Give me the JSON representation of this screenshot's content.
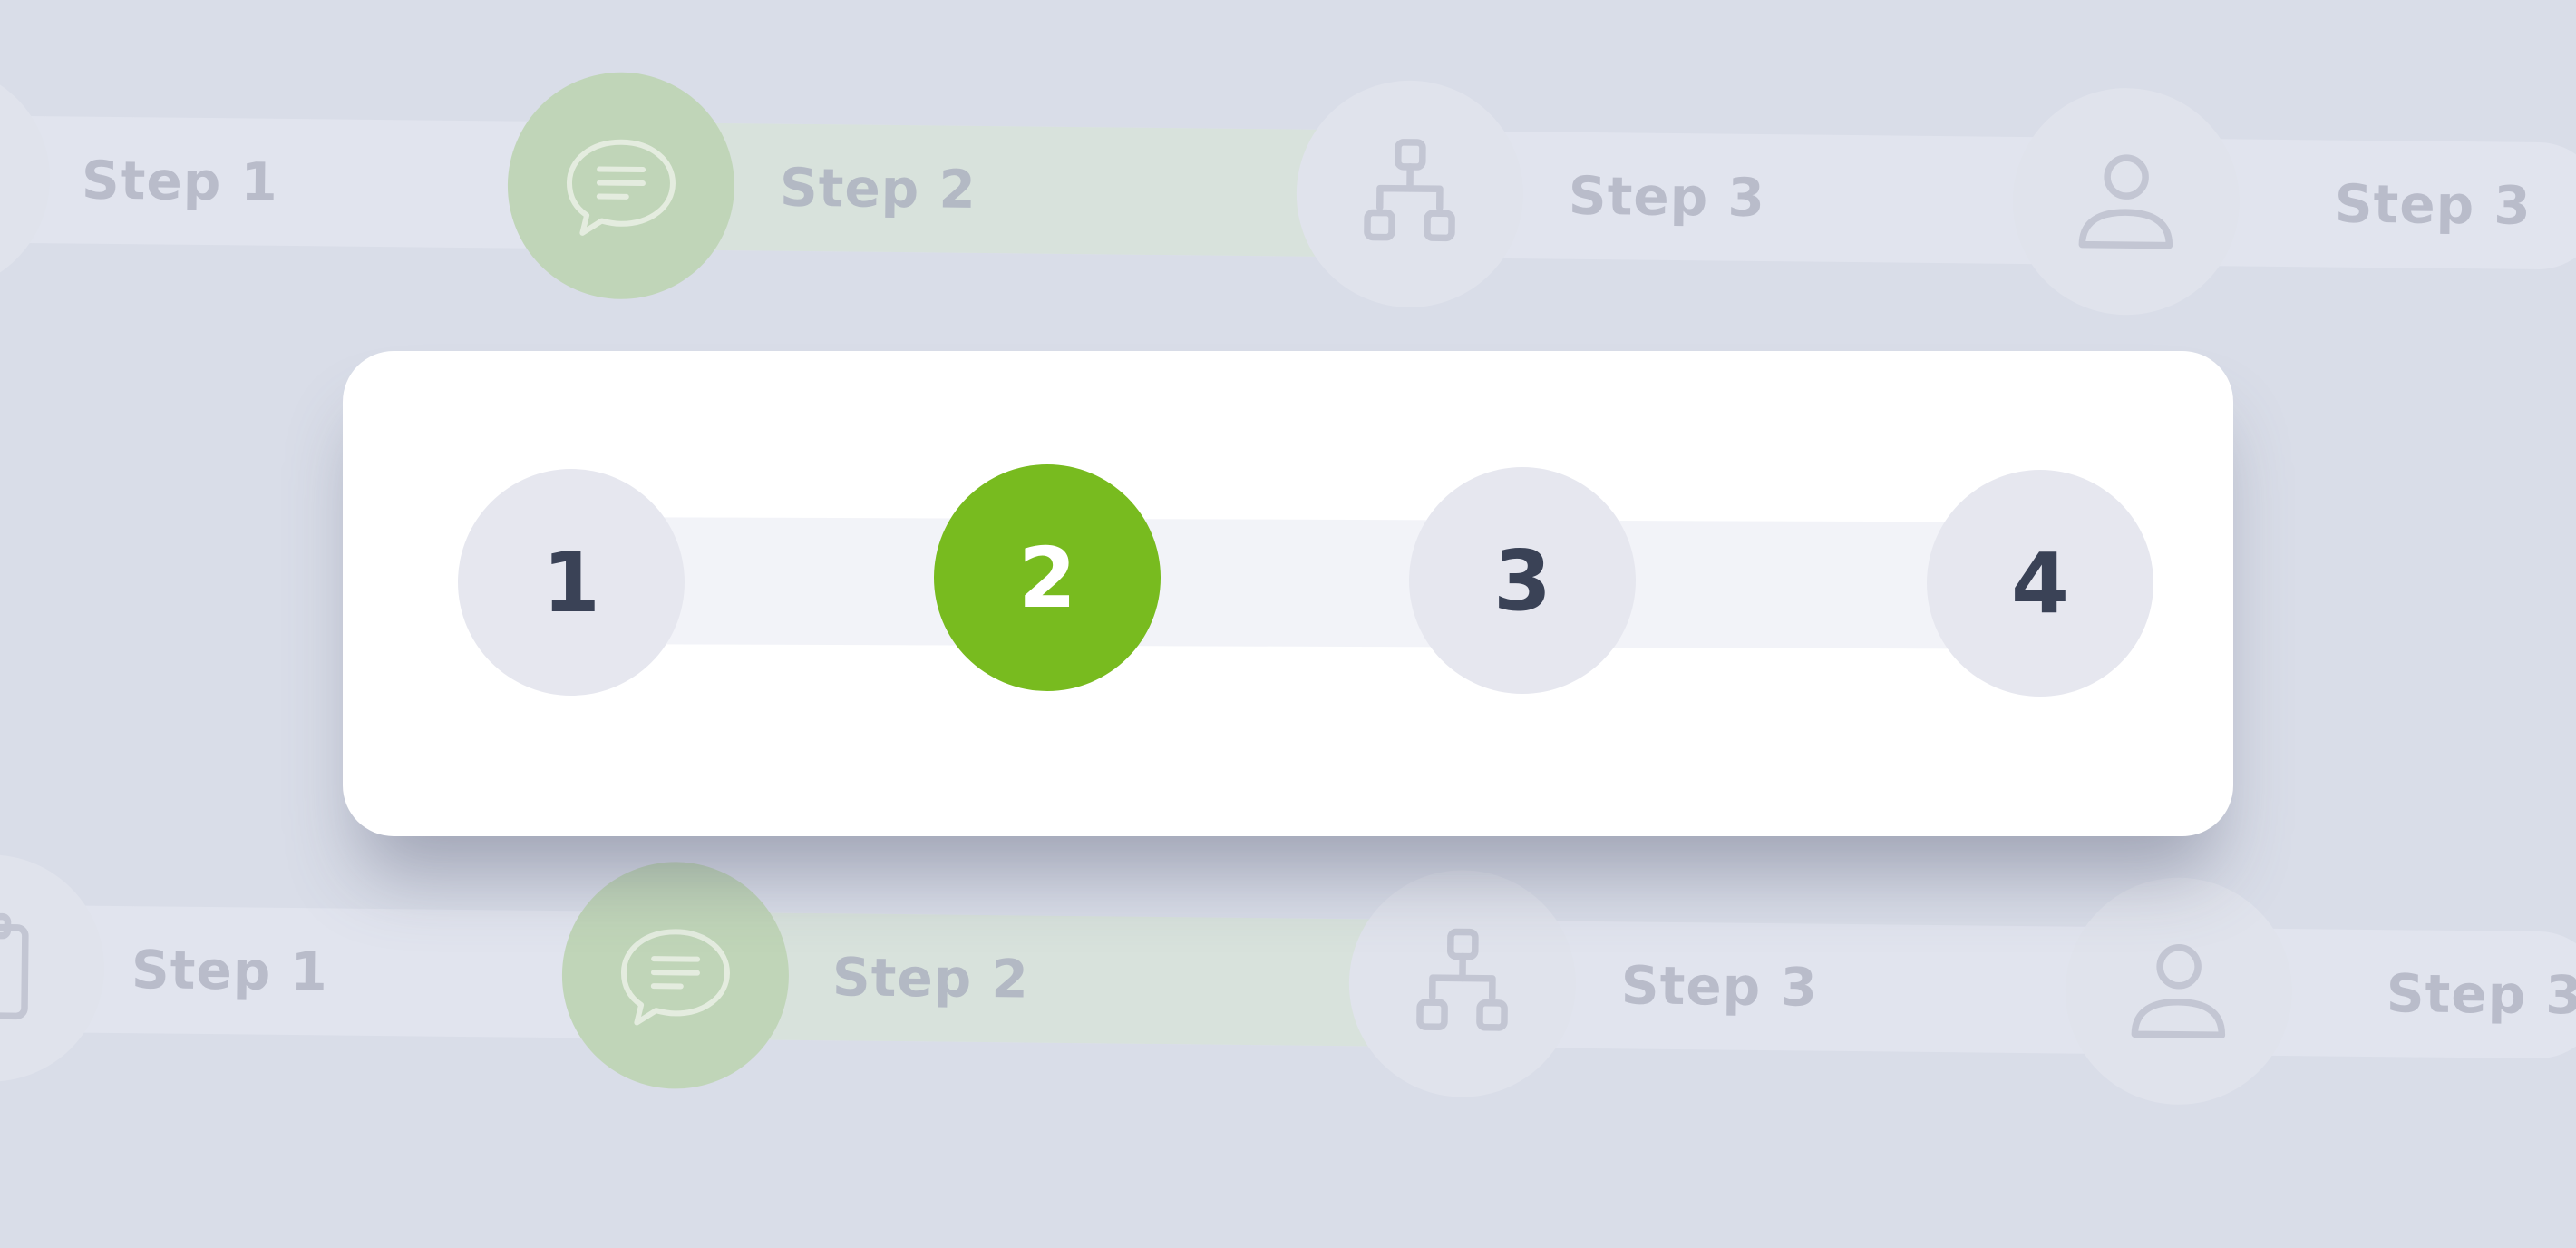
{
  "colors": {
    "background": "#d9dde8",
    "active": "#78bb1f",
    "inactive_node": "#e6e7ef",
    "number_text": "#3a4256",
    "faded_active": "#c0d5b8"
  },
  "background_stepper_top": {
    "active_index": 1,
    "steps": [
      {
        "label": "Step 1",
        "icon": "clipboard-icon"
      },
      {
        "label": "Step 2",
        "icon": "chat-icon"
      },
      {
        "label": "Step 3",
        "icon": "hierarchy-icon"
      },
      {
        "label": "Step 3",
        "icon": "user-icon"
      }
    ]
  },
  "background_stepper_bottom": {
    "active_index": 1,
    "steps": [
      {
        "label": "Step 1",
        "icon": "clipboard-icon"
      },
      {
        "label": "Step 2",
        "icon": "chat-icon"
      },
      {
        "label": "Step 3",
        "icon": "hierarchy-icon"
      },
      {
        "label": "Step 3",
        "icon": "user-icon"
      }
    ]
  },
  "main_stepper": {
    "active_index": 1,
    "steps": [
      {
        "number": "1"
      },
      {
        "number": "2"
      },
      {
        "number": "3"
      },
      {
        "number": "4"
      }
    ]
  }
}
